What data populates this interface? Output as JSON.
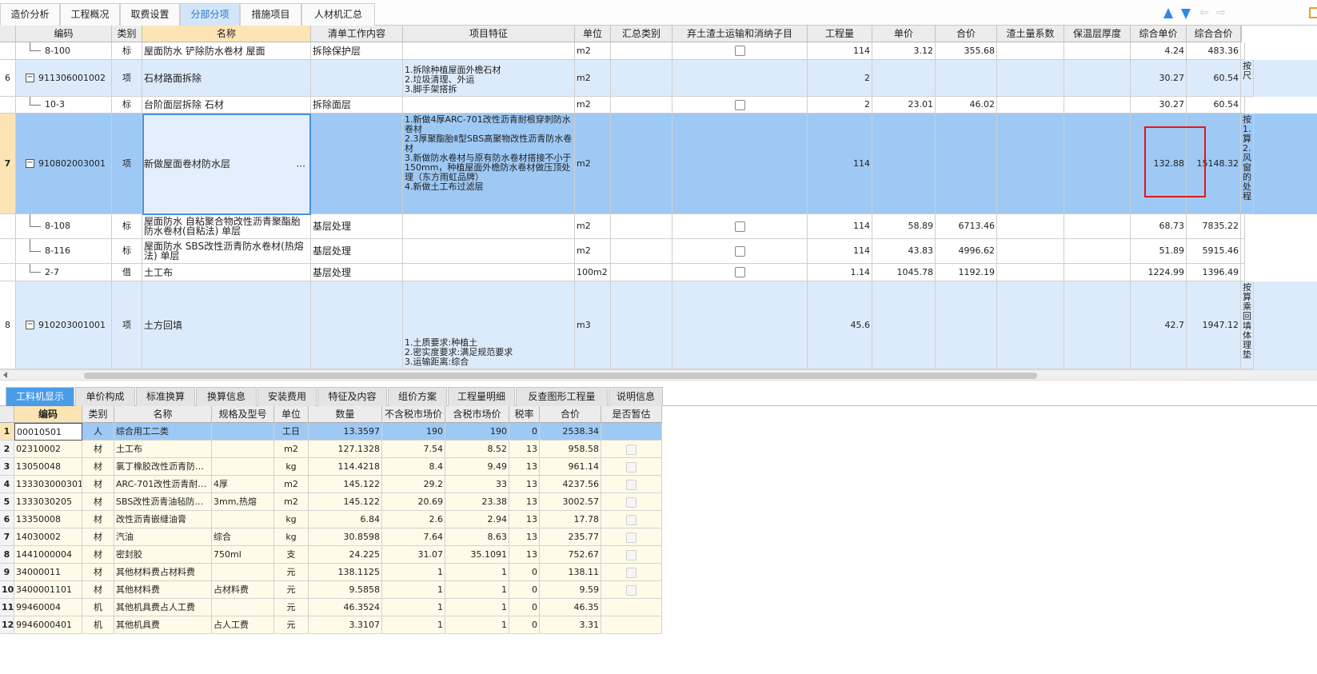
{
  "tabs": [
    {
      "label": "造价分析"
    },
    {
      "label": "工程概况"
    },
    {
      "label": "取费设置"
    },
    {
      "label": "分部分项"
    },
    {
      "label": "措施项目"
    },
    {
      "label": "人材机汇总"
    }
  ],
  "toolbar": {
    "icons": [
      "arrow-up-icon",
      "arrow-down-icon",
      "arrow-left-icon",
      "arrow-right-icon",
      "grid-settings-icon"
    ]
  },
  "colors": {
    "accent": "#2e88e8",
    "selected_row": "#9ec9f5",
    "parent_row": "#dcebfb",
    "highlight_box": "#e01818",
    "active_tab": "#4a9be8"
  },
  "main_columns": [
    "编码",
    "类别",
    "名称",
    "清单工作内容",
    "项目特征",
    "单位",
    "汇总类别",
    "弃土渣土运输和消纳子目",
    "工程量",
    "单价",
    "合价",
    "渣土量系数",
    "保温层厚度",
    "综合单价",
    "综合合价",
    ""
  ],
  "main_rows": [
    {
      "num": "",
      "code": "8-100",
      "type": "标",
      "name": "屋面防水 铲除防水卷材 屋面",
      "work": "拆除保护层",
      "feature": "",
      "unit": "m2",
      "qty": "114",
      "price": "3.12",
      "total": "355.68",
      "uprice": "4.24",
      "utotal": "483.36",
      "extra": ""
    },
    {
      "num": "6",
      "code": "911306001002",
      "type": "项",
      "name": "石材路面拆除",
      "work": "",
      "feature": "1.拆除种植屋面外檐石材\n2.垃圾清理、外运\n3.脚手架搭拆",
      "unit": "m2",
      "qty": "2",
      "price": "",
      "total": "",
      "uprice": "30.27",
      "utotal": "60.54",
      "extra": "按\n尺"
    },
    {
      "num": "",
      "code": "10-3",
      "type": "标",
      "name": "台阶面层拆除 石材",
      "work": "拆除面层",
      "feature": "",
      "unit": "m2",
      "qty": "2",
      "price": "23.01",
      "total": "46.02",
      "uprice": "30.27",
      "utotal": "60.54",
      "extra": ""
    },
    {
      "num": "7",
      "code": "910802003001",
      "type": "项",
      "name": "新做屋面卷材防水层",
      "work": "",
      "feature": "1.新做4厚ARC-701改性沥青耐根穿刺防水卷材\n2.3厚聚酯胎Ⅱ型SBS高聚物改性沥青防水卷材\n3.新做防水卷材与原有防水卷材搭接不小于150mm，种植屋面外檐防水卷材做压顶处理（东方雨虹品牌）\n4.新做土工布过滤层",
      "unit": "m2",
      "qty": "114",
      "price": "",
      "total": "",
      "uprice": "132.88",
      "utotal": "15148.32",
      "extra": "按\n1.\n算\n2.\n风\n窗\n的\n处\n程"
    },
    {
      "num": "",
      "code": "8-108",
      "type": "标",
      "name": "屋面防水 自粘聚合物改性沥青聚酯胎防水卷材(自粘法) 单层",
      "work": "基层处理",
      "feature": "",
      "unit": "m2",
      "qty": "114",
      "price": "58.89",
      "total": "6713.46",
      "uprice": "68.73",
      "utotal": "7835.22",
      "extra": ""
    },
    {
      "num": "",
      "code": "8-116",
      "type": "标",
      "name": "屋面防水 SBS改性沥青防水卷材(热熔法) 单层",
      "work": "基层处理",
      "feature": "",
      "unit": "m2",
      "qty": "114",
      "price": "43.83",
      "total": "4996.62",
      "uprice": "51.89",
      "utotal": "5915.46",
      "extra": ""
    },
    {
      "num": "",
      "code": "2-7",
      "type": "借",
      "name": "土工布",
      "work": "基层处理",
      "feature": "",
      "unit": "100m2",
      "qty": "1.14",
      "price": "1045.78",
      "total": "1192.19",
      "uprice": "1224.99",
      "utotal": "1396.49",
      "extra": ""
    },
    {
      "num": "8",
      "code": "910203001001",
      "type": "项",
      "name": "土方回填",
      "work": "",
      "feature": "1.土质要求:种植土\n2.密实度要求:满足规范要求\n3.运输距离:综合",
      "unit": "m3",
      "qty": "45.6",
      "price": "",
      "total": "",
      "uprice": "42.7",
      "utotal": "1947.12",
      "extra": "按\n算\n乘\n回\n填\n体\n理\n垫"
    }
  ],
  "ellipsis": "···",
  "bottom_tabs": [
    "工料机显示",
    "单价构成",
    "标准换算",
    "换算信息",
    "安装费用",
    "特征及内容",
    "组价方案",
    "工程量明细",
    "反查图形工程量",
    "说明信息"
  ],
  "bottom_columns": [
    "",
    "编码",
    "类别",
    "名称",
    "规格及型号",
    "单位",
    "数量",
    "不含税市场价",
    "含税市场价",
    "税率",
    "合价",
    "是否暂估"
  ],
  "bottom_rows": [
    {
      "n": "1",
      "code": "00010501",
      "type": "人",
      "name": "综合用工二类",
      "spec": "",
      "unit": "工日",
      "qty": "13.3597",
      "p1": "190",
      "p2": "190",
      "tax": "0",
      "total": "2538.34",
      "cb": false
    },
    {
      "n": "2",
      "code": "02310002",
      "type": "材",
      "name": "土工布",
      "spec": "",
      "unit": "m2",
      "qty": "127.1328",
      "p1": "7.54",
      "p2": "8.52",
      "tax": "13",
      "total": "958.58",
      "cb": true
    },
    {
      "n": "3",
      "code": "13050048",
      "type": "材",
      "name": "氯丁橡胶改性沥青防…",
      "spec": "",
      "unit": "kg",
      "qty": "114.4218",
      "p1": "8.4",
      "p2": "9.49",
      "tax": "13",
      "total": "961.14",
      "cb": true
    },
    {
      "n": "4",
      "code": "133303000301",
      "type": "材",
      "name": "ARC-701改性沥青耐…",
      "spec": "4厚",
      "unit": "m2",
      "qty": "145.122",
      "p1": "29.2",
      "p2": "33",
      "tax": "13",
      "total": "4237.56",
      "cb": true
    },
    {
      "n": "5",
      "code": "1333030205",
      "type": "材",
      "name": "SBS改性沥青油毡防…",
      "spec": "3mm,热熔",
      "unit": "m2",
      "qty": "145.122",
      "p1": "20.69",
      "p2": "23.38",
      "tax": "13",
      "total": "3002.57",
      "cb": true
    },
    {
      "n": "6",
      "code": "13350008",
      "type": "材",
      "name": "改性沥青嵌缝油膏",
      "spec": "",
      "unit": "kg",
      "qty": "6.84",
      "p1": "2.6",
      "p2": "2.94",
      "tax": "13",
      "total": "17.78",
      "cb": true
    },
    {
      "n": "7",
      "code": "14030002",
      "type": "材",
      "name": "汽油",
      "spec": "综合",
      "unit": "kg",
      "qty": "30.8598",
      "p1": "7.64",
      "p2": "8.63",
      "tax": "13",
      "total": "235.77",
      "cb": true
    },
    {
      "n": "8",
      "code": "1441000004",
      "type": "材",
      "name": "密封胶",
      "spec": "750ml",
      "unit": "支",
      "qty": "24.225",
      "p1": "31.07",
      "p2": "35.1091",
      "tax": "13",
      "total": "752.67",
      "cb": true
    },
    {
      "n": "9",
      "code": "34000011",
      "type": "材",
      "name": "其他材料费占材料费",
      "spec": "",
      "unit": "元",
      "qty": "138.1125",
      "p1": "1",
      "p2": "1",
      "tax": "0",
      "total": "138.11",
      "cb": true
    },
    {
      "n": "10",
      "code": "3400001101",
      "type": "材",
      "name": "其他材料费",
      "spec": "占材料费",
      "unit": "元",
      "qty": "9.5858",
      "p1": "1",
      "p2": "1",
      "tax": "0",
      "total": "9.59",
      "cb": true
    },
    {
      "n": "11",
      "code": "99460004",
      "type": "机",
      "name": "其他机具费占人工费",
      "spec": "",
      "unit": "元",
      "qty": "46.3524",
      "p1": "1",
      "p2": "1",
      "tax": "0",
      "total": "46.35",
      "cb": false
    },
    {
      "n": "12",
      "code": "9946000401",
      "type": "机",
      "name": "其他机具费",
      "spec": "占人工费",
      "unit": "元",
      "qty": "3.3107",
      "p1": "1",
      "p2": "1",
      "tax": "0",
      "total": "3.31",
      "cb": false
    }
  ]
}
